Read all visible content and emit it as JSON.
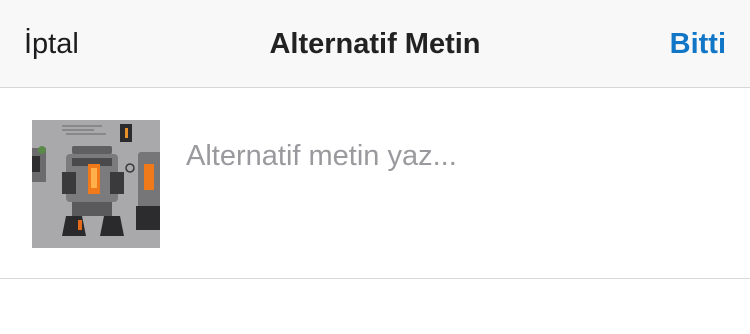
{
  "navbar": {
    "cancel_label": "İptal",
    "title": "Alternatif Metin",
    "done_label": "Bitti"
  },
  "editor": {
    "alt_text_value": "",
    "alt_text_placeholder": "Alternatif metin yaz..."
  },
  "colors": {
    "accent": "#1276c7",
    "navbar_bg": "#f8f8f8",
    "placeholder": "#9a9a9e"
  }
}
